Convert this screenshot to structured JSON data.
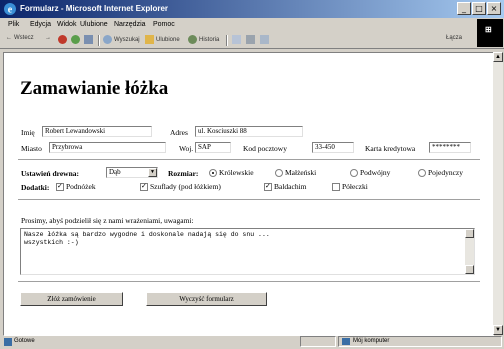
{
  "window": {
    "title": "Formularz - Microsoft Internet Explorer",
    "controls": [
      "_",
      "□",
      "×"
    ]
  },
  "menu": {
    "items": [
      "Plik",
      "Edycja",
      "Widok",
      "Ulubione",
      "Narzędzia",
      "Pomoc"
    ]
  },
  "toolbar": {
    "back": "Wstecz",
    "search": "Wyszukaj",
    "favorites": "Ulubione",
    "history": "Historia",
    "links": "Łącza"
  },
  "page": {
    "heading": "Zamawianie łóżka",
    "fields": {
      "name_label": "Imię",
      "name_value": "Robert Lewandowski",
      "address_label": "Adres",
      "address_value": "ul. Kosciuszki 88",
      "city_label": "Miasto",
      "city_value": "Przybrowa",
      "state_label": "Woj.",
      "state_value": "SAP",
      "zip_label": "Kod pocztowy",
      "zip_value": "33-450",
      "card_label": "Karta kredytowa",
      "card_value": "********"
    },
    "wood": {
      "label": "Ustawień drewna:",
      "selected": "Dąb"
    },
    "size": {
      "label": "Rozmiar:",
      "options": [
        {
          "text": "Królewskie",
          "selected": true
        },
        {
          "text": "Małżeński",
          "selected": false
        },
        {
          "text": "Podwójny",
          "selected": false
        },
        {
          "text": "Pojedynczy",
          "selected": false
        }
      ]
    },
    "extras": {
      "label": "Dodatki:",
      "options": [
        {
          "text": "Podnóżek",
          "checked": true
        },
        {
          "text": "Szuflady (pod łóżkiem)",
          "checked": true
        },
        {
          "text": "Baldachim",
          "checked": true
        },
        {
          "text": "Półeczki",
          "checked": false
        }
      ]
    },
    "comments": {
      "label": "Prosimy, abyś podzielił się z nami wrażeniami, uwagami:",
      "value": "Nasze łóżka są bardzo wygodne i doskonale nadają się do snu ...\nwszystkich :-)"
    },
    "buttons": {
      "submit": "Złóż zamówienie",
      "reset": "Wyczyść formularz"
    }
  },
  "status": {
    "left": "Gotowe",
    "zone": "Mój komputer"
  },
  "colors": {
    "titlebar_start": "#0a246a",
    "titlebar_end": "#a6caf0",
    "chrome": "#d4d0c8"
  }
}
